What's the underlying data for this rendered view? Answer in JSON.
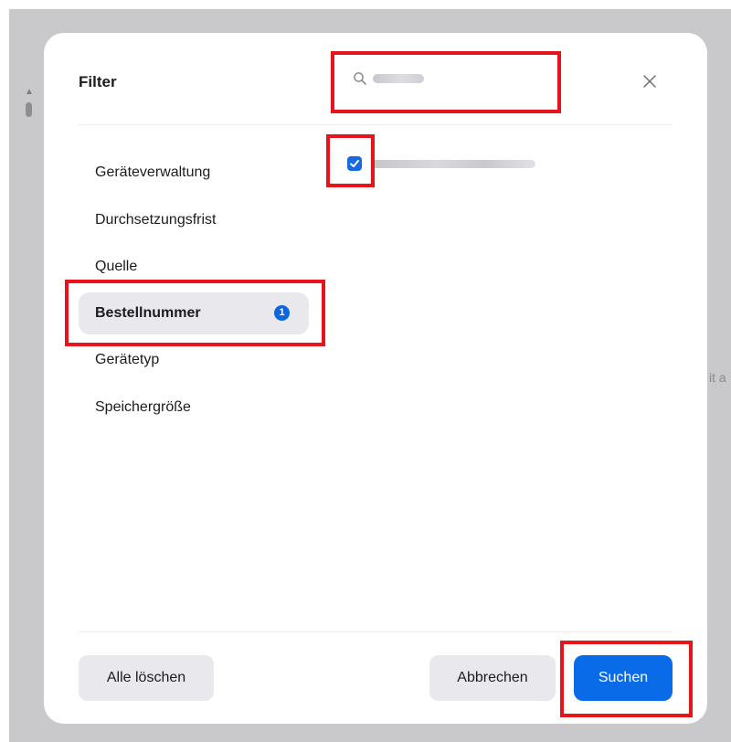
{
  "background": {
    "partial_text": "it a"
  },
  "dialog": {
    "title": "Filter",
    "search": {
      "value": "",
      "placeholder": ""
    },
    "categories": [
      {
        "label": "Geräteverwaltung",
        "selected": false
      },
      {
        "label": "Durchsetzungsfrist",
        "selected": false
      },
      {
        "label": "Quelle",
        "selected": false
      },
      {
        "label": "Bestellnummer",
        "selected": true,
        "badge": "1"
      },
      {
        "label": "Gerätetyp",
        "selected": false
      },
      {
        "label": "Speichergröße",
        "selected": false
      }
    ],
    "options": [
      {
        "checked": true
      }
    ],
    "buttons": {
      "clear_all": "Alle löschen",
      "cancel": "Abbrechen",
      "search": "Suchen"
    }
  },
  "icons": {
    "search": "magnifier-icon",
    "close": "close-icon",
    "check": "checkmark-icon",
    "scroll_up": "scroll-up-arrow-icon"
  },
  "colors": {
    "accent": "#0a6be8",
    "badge": "#0a67e0",
    "highlight": "#e8141c",
    "backdrop": "#c9c9cb",
    "selected_bg": "#e9e9ed"
  }
}
